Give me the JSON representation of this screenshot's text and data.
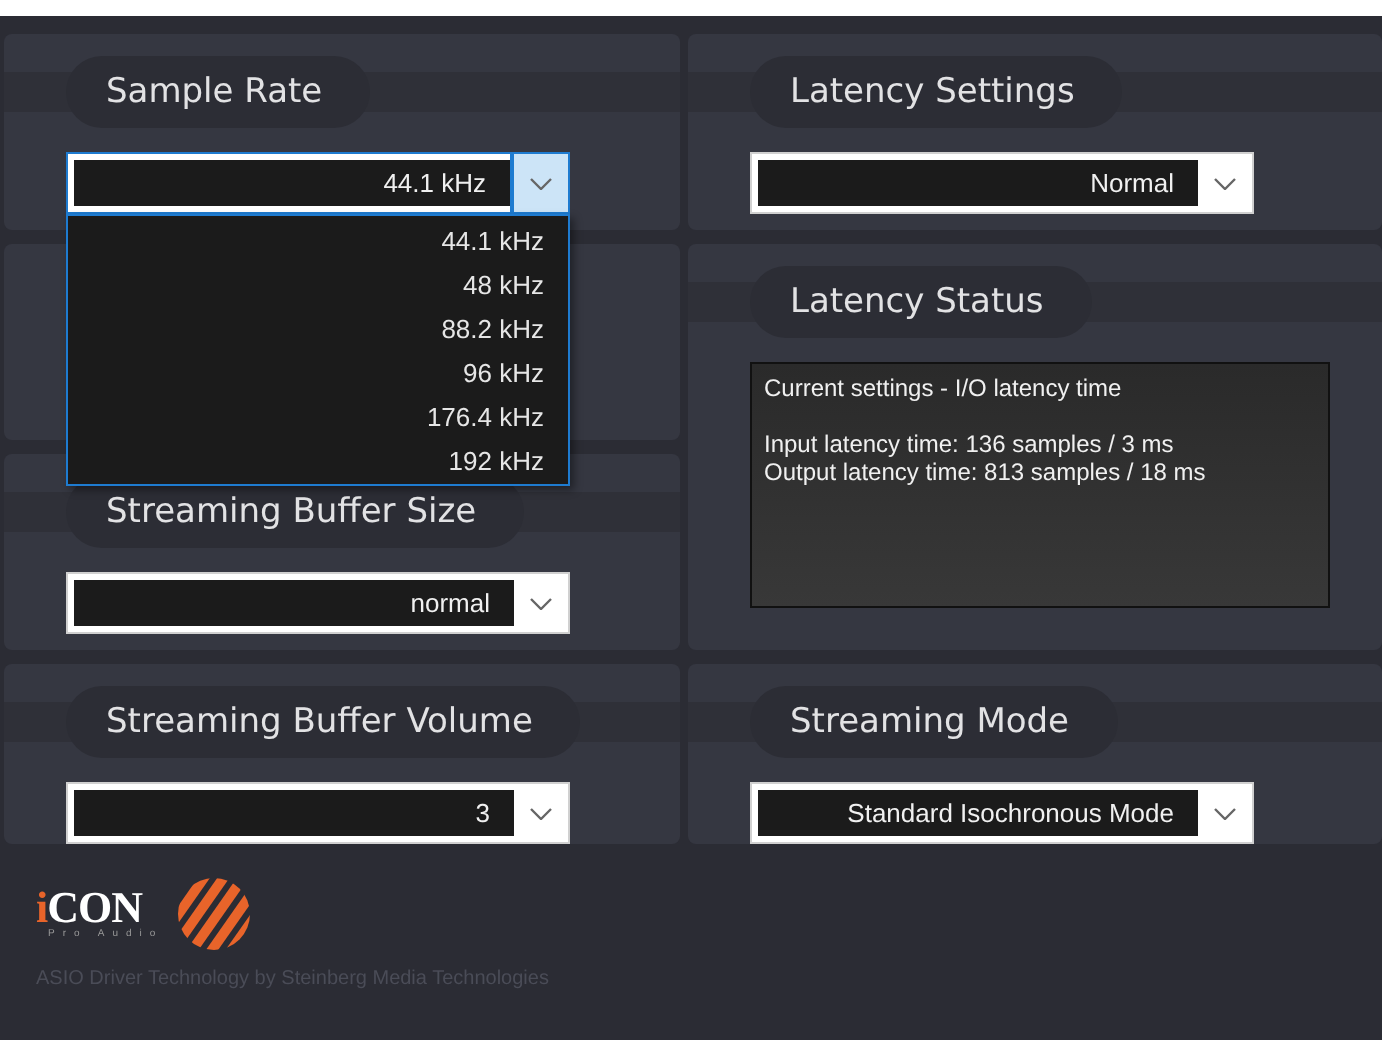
{
  "left": [
    {
      "kind": "combo",
      "title": "Sample Rate",
      "value": "44.1 kHz",
      "expanded": true,
      "options": [
        "44.1 kHz",
        "48 kHz",
        "88.2 kHz",
        "96 kHz",
        "176.4 kHz",
        "192 kHz"
      ]
    },
    {
      "kind": "blank"
    },
    {
      "kind": "combo",
      "title": "Streaming Buffer Size",
      "value": "normal",
      "expanded": false
    },
    {
      "kind": "combo",
      "title": "Streaming Buffer Volume",
      "value": "3",
      "expanded": false
    }
  ],
  "right": [
    {
      "kind": "combo",
      "title": "Latency Settings",
      "value": "Normal",
      "expanded": false
    },
    {
      "kind": "status",
      "title": "Latency Status",
      "paragraphs": [
        [
          "Current settings - I/O latency time"
        ],
        [
          "Input latency time: 136 samples / 3 ms",
          "Output latency time: 813 samples / 18 ms"
        ]
      ]
    },
    {
      "kind": "combo",
      "title": "Streaming Mode",
      "value": "Standard Isochronous Mode",
      "expanded": false
    }
  ],
  "footer": {
    "logo": "iCON",
    "logo_tagline": "Pro Audio",
    "credit": "ASIO Driver Technology by Steinberg Media Technologies"
  }
}
